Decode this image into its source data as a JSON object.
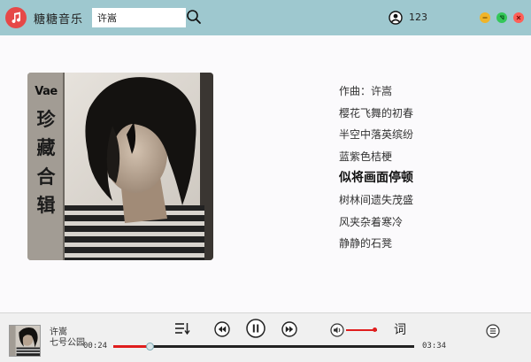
{
  "app": {
    "title": "糖糖音乐"
  },
  "search": {
    "value": "许嵩"
  },
  "user": {
    "name": "123"
  },
  "album_cover": {
    "brand": "Vae",
    "title_chars": [
      "珍",
      "藏",
      "合",
      "辑"
    ]
  },
  "lyrics": {
    "lines": [
      "作曲：许嵩",
      "樱花飞舞的初春",
      "半空中落英缤纷",
      "蓝紫色桔梗",
      "似将画面停顿",
      "树林间遗失茂盛",
      "风夹杂着寒冷",
      "静静的石凳"
    ],
    "current_index": 4
  },
  "player": {
    "song_title": "许嵩",
    "album": "七号公园",
    "time_current": "00:24",
    "time_total": "03:34",
    "progress": 0.12,
    "volume": 0.9,
    "lyric_toggle_label": "词"
  },
  "colors": {
    "titlebar": "#9ec8cf",
    "accent": "#e01e1e",
    "logo": "#e64848"
  },
  "icons": [
    "music-note-icon",
    "search-icon",
    "user-icon",
    "minimize-icon",
    "maximize-icon",
    "close-icon",
    "playlist-icon",
    "prev-icon",
    "pause-icon",
    "next-icon",
    "volume-icon",
    "menu-icon"
  ]
}
